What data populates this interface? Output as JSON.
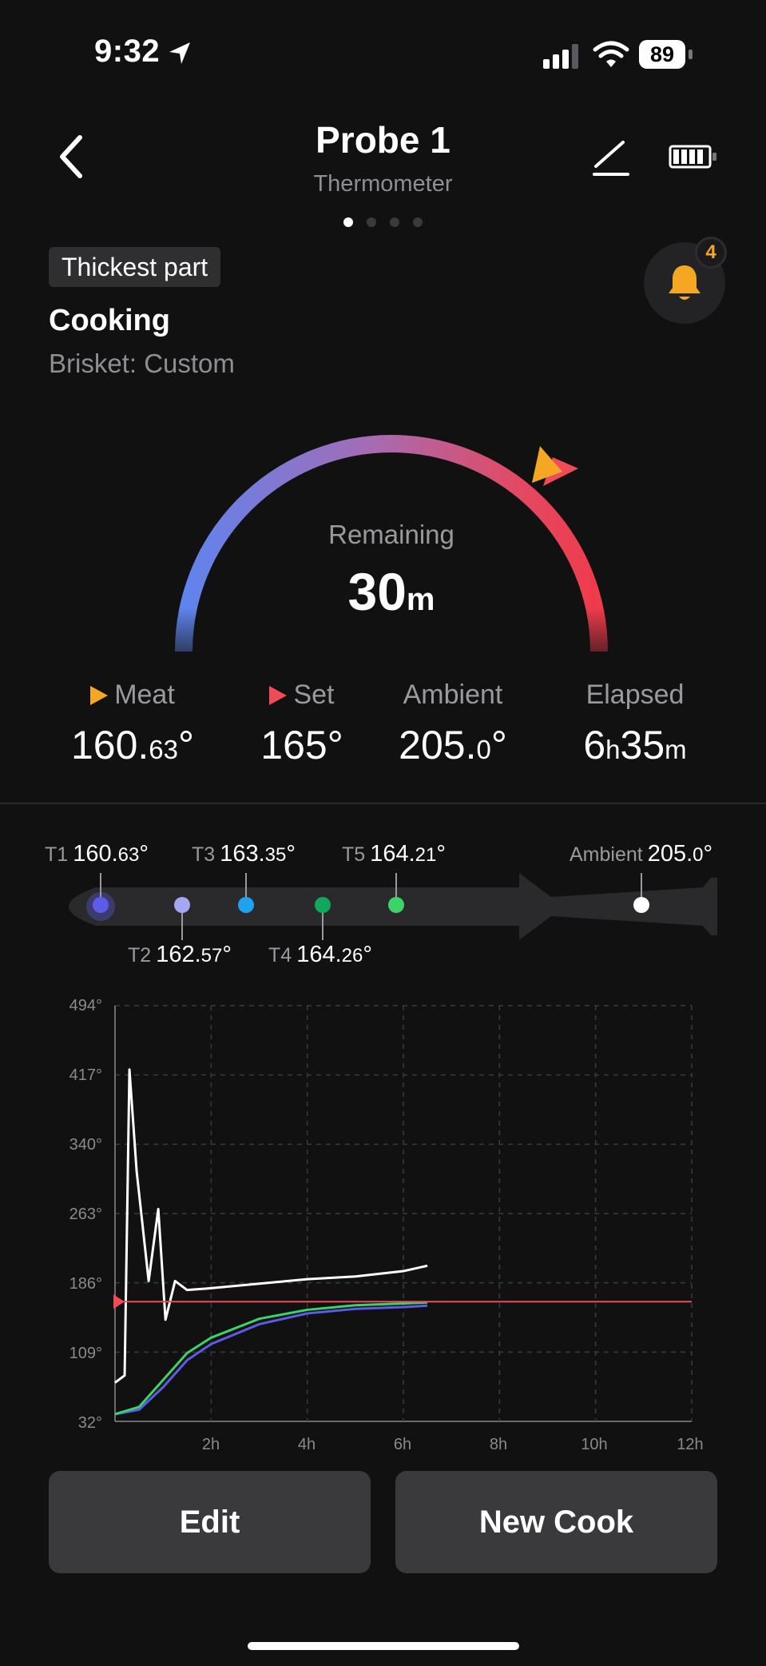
{
  "status_bar": {
    "time": "9:32",
    "battery": "89"
  },
  "header": {
    "title": "Probe 1",
    "subtitle": "Thermometer",
    "page_count": 4,
    "active_page": 0
  },
  "tag": "Thickest part",
  "notifications": {
    "count": "4"
  },
  "state": {
    "title": "Cooking",
    "subtitle": "Brisket: Custom"
  },
  "gauge": {
    "label": "Remaining",
    "value": "30",
    "unit": "m"
  },
  "stats": {
    "meat": {
      "label": "Meat",
      "value_main": "160.",
      "value_frac": "63",
      "value_unit": "°"
    },
    "set": {
      "label": "Set",
      "value_main": "165",
      "value_unit": "°"
    },
    "ambient": {
      "label": "Ambient",
      "value_main": "205.",
      "value_frac": "0",
      "value_unit": "°"
    },
    "elapsed": {
      "label": "Elapsed",
      "hours": "6",
      "h_unit": "h",
      "minutes": "35",
      "m_unit": "m"
    }
  },
  "probe_sensors": [
    {
      "label": "T1",
      "main": "160.",
      "frac": "63",
      "unit": "°",
      "color": "#5b5ce8"
    },
    {
      "label": "T2",
      "main": "162.",
      "frac": "57",
      "unit": "°",
      "color": "#a3a8f0"
    },
    {
      "label": "T3",
      "main": "163.",
      "frac": "35",
      "unit": "°",
      "color": "#1fa3f0"
    },
    {
      "label": "T4",
      "main": "164.",
      "frac": "26",
      "unit": "°",
      "color": "#12a85c"
    },
    {
      "label": "T5",
      "main": "164.",
      "frac": "21",
      "unit": "°",
      "color": "#3bd36a"
    },
    {
      "label": "Ambient",
      "main": "205.",
      "frac": "0",
      "unit": "°",
      "color": "#ffffff"
    }
  ],
  "chart": {
    "y_ticks": [
      "494°",
      "417°",
      "340°",
      "263°",
      "186°",
      "109°",
      "32°"
    ],
    "x_ticks": [
      "2h",
      "4h",
      "6h",
      "8h",
      "10h",
      "12h"
    ],
    "set_color": "#ef4b58"
  },
  "chart_data": {
    "type": "line",
    "xlabel": "",
    "ylabel": "",
    "xlim": [
      0,
      12
    ],
    "ylim": [
      32,
      494
    ],
    "series": [
      {
        "color": "#ffffff",
        "x": [
          0,
          0.2,
          0.3,
          0.45,
          0.7,
          0.9,
          1.05,
          1.25,
          1.5,
          2,
          3,
          4,
          5,
          6,
          6.5
        ],
        "y": [
          75,
          83,
          423,
          310,
          188,
          268,
          145,
          188,
          178,
          180,
          185,
          190,
          193,
          199,
          205
        ]
      },
      {
        "color": "#5b5ce8",
        "x": [
          0,
          0.5,
          1,
          1.5,
          2,
          3,
          4,
          5,
          6,
          6.5
        ],
        "y": [
          40,
          45,
          70,
          100,
          118,
          140,
          152,
          157,
          159,
          160.6
        ]
      },
      {
        "color": "#3bd36a",
        "x": [
          0,
          0.5,
          1,
          1.5,
          2,
          3,
          4,
          5,
          6,
          6.5
        ],
        "y": [
          40,
          48,
          78,
          108,
          125,
          146,
          156,
          161,
          163,
          164.2
        ]
      },
      {
        "color": "#ef4b58",
        "x": [
          0,
          12
        ],
        "y": [
          165,
          165
        ]
      }
    ]
  },
  "actions": {
    "edit": "Edit",
    "new_cook": "New Cook"
  }
}
